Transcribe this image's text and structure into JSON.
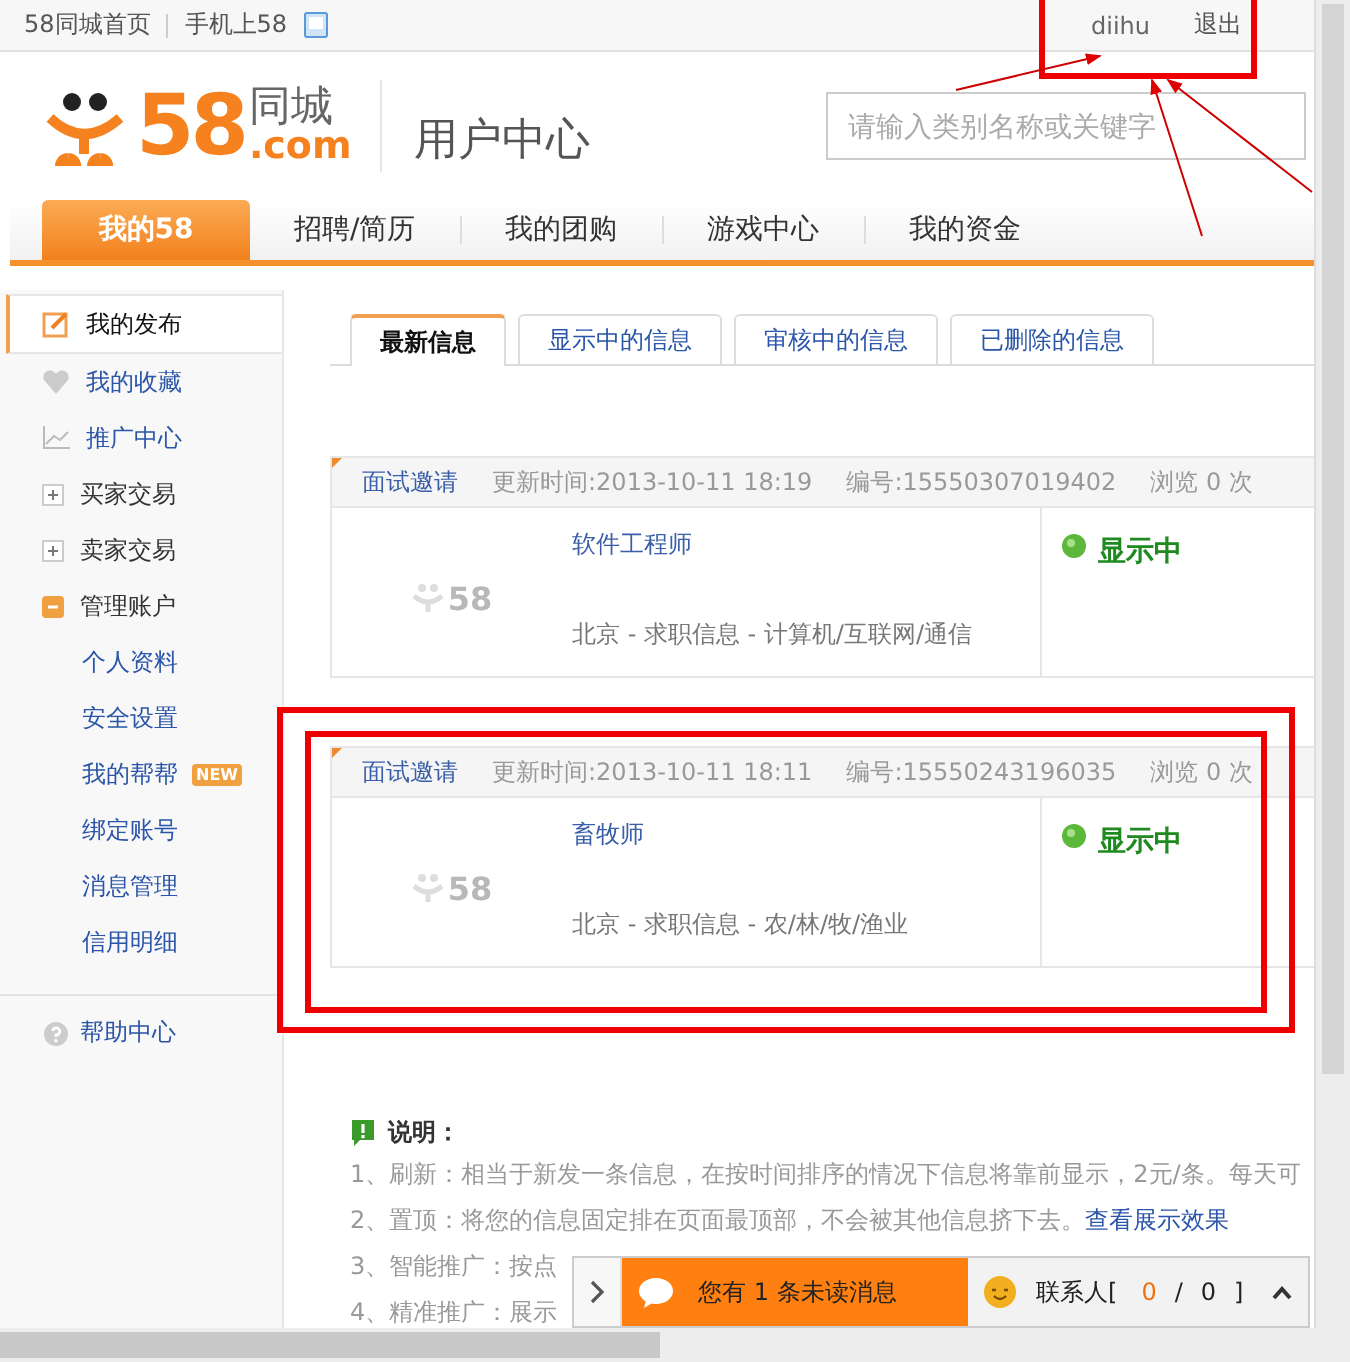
{
  "topbar": {
    "links": [
      {
        "label": "58同城首页"
      },
      {
        "label": "手机上58"
      }
    ],
    "user": "diihu",
    "logout": "退出"
  },
  "header": {
    "logo": {
      "number": "58",
      "domain": ".com",
      "name": "同城"
    },
    "title": "用户中心",
    "search": {
      "placeholder": "请输入类别名称或关键字"
    }
  },
  "nav": [
    {
      "label": "我的58",
      "selected": true
    },
    {
      "label": "招聘/简历",
      "selected": false
    },
    {
      "label": "我的团购",
      "selected": false
    },
    {
      "label": "游戏中心",
      "selected": false
    },
    {
      "label": "我的资金",
      "selected": false
    }
  ],
  "sidebar": {
    "items": [
      {
        "label": "我的发布",
        "kind": "link",
        "selected": true
      },
      {
        "label": "我的收藏",
        "kind": "link",
        "selected": false
      },
      {
        "label": "推广中心",
        "kind": "link",
        "selected": false
      },
      {
        "label": "买家交易",
        "kind": "group",
        "expanded": false,
        "selected": false
      },
      {
        "label": "卖家交易",
        "kind": "group",
        "expanded": false,
        "selected": false
      },
      {
        "label": "管理账户",
        "kind": "group",
        "expanded": true,
        "selected": false,
        "children": [
          {
            "label": "个人资料"
          },
          {
            "label": "安全设置"
          },
          {
            "label": "我的帮帮",
            "badge": "NEW"
          },
          {
            "label": "绑定账号"
          },
          {
            "label": "消息管理"
          },
          {
            "label": "信用明细"
          }
        ]
      }
    ],
    "help": "帮助中心"
  },
  "tabs": [
    {
      "label": "最新信息",
      "selected": true
    },
    {
      "label": "显示中的信息",
      "selected": false
    },
    {
      "label": "审核中的信息",
      "selected": false
    },
    {
      "label": "已删除的信息",
      "selected": false
    }
  ],
  "listings": [
    {
      "tag": "面试邀请",
      "updated": "更新时间:2013-10-11 18:19",
      "number": "编号:15550307019402",
      "views": "浏览 0 次",
      "thumbnail_text": "58",
      "title": "软件工程师",
      "category": "北京 - 求职信息 - 计算机/互联网/通信",
      "status": "显示中"
    },
    {
      "tag": "面试邀请",
      "updated": "更新时间:2013-10-11 18:11",
      "number": "编号:15550243196035",
      "views": "浏览 0 次",
      "thumbnail_text": "58",
      "title": "畜牧师",
      "category": "北京 - 求职信息 - 农/林/牧/渔业",
      "status": "显示中"
    }
  ],
  "notes": {
    "title": "说明：",
    "lines": [
      {
        "text": "1、刷新：相当于新发一条信息，在按时间排序的情况下信息将靠前显示，2元/条。每天可"
      },
      {
        "text": "2、置顶：将您的信息固定排在页面最顶部，不会被其他信息挤下去。",
        "link": "查看展示效果"
      },
      {
        "text": "3、智能推广：按点"
      },
      {
        "text": "4、精准推广：展示"
      }
    ]
  },
  "chat": {
    "message": "您有 1 条未读消息",
    "contacts_label": "联系人[",
    "online": "0",
    "separator": "/",
    "total": "0",
    "close_bracket": "]"
  }
}
